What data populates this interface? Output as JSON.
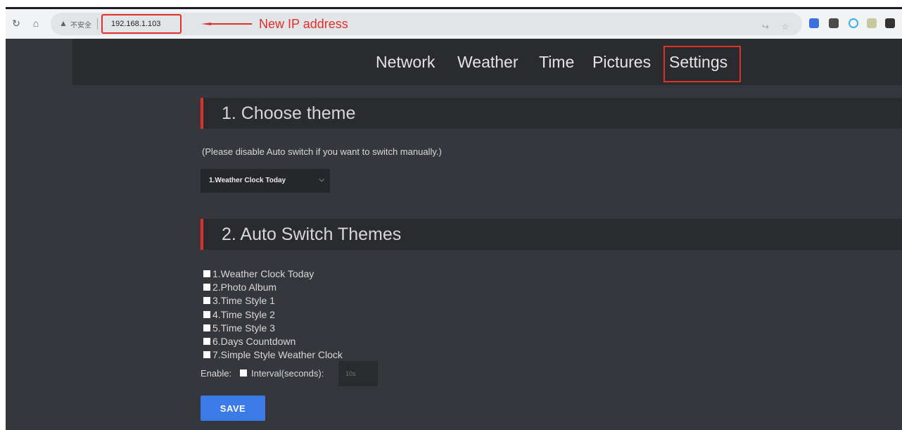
{
  "browser": {
    "insecure_label": "不安全",
    "url": "192.168.1.103",
    "annotation": "New IP address"
  },
  "nav": {
    "items": [
      "Network",
      "Weather",
      "Time",
      "Pictures",
      "Settings"
    ],
    "active": "Settings"
  },
  "section1": {
    "title": "1. Choose theme",
    "note": "(Please disable Auto switch if you want to switch manually.)",
    "selected_theme": "1.Weather Clock Today"
  },
  "section2": {
    "title": "2. Auto Switch Themes",
    "themes": [
      "1.Weather Clock Today",
      "2.Photo Album",
      "3.Time Style 1",
      "4.Time Style 2",
      "5.Time Style 3",
      "6.Days Countdown",
      "7.Simple Style Weather Clock"
    ],
    "enable_label": "Enable:",
    "interval_label": "Interval(seconds):",
    "interval_placeholder": "10s"
  },
  "save_label": "SAVE",
  "colors": {
    "accent_red": "#e0302a",
    "save_blue": "#3a7be8",
    "background": "#35373c",
    "header": "#2a2b2e"
  }
}
